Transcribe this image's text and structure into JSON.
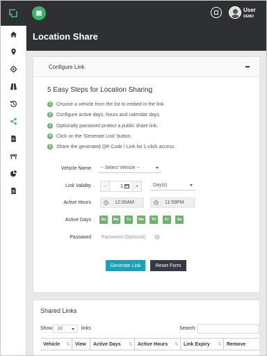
{
  "header": {
    "user_name": "User",
    "user_role": "DEMO"
  },
  "sidebar": {
    "items": [
      {
        "icon": "home-icon"
      },
      {
        "icon": "map-pin-icon"
      },
      {
        "icon": "crosshair-icon"
      },
      {
        "icon": "road-icon"
      },
      {
        "icon": "history-icon"
      },
      {
        "icon": "share-icon"
      },
      {
        "icon": "document-icon"
      },
      {
        "icon": "barrier-icon"
      },
      {
        "icon": "pie-chart-icon"
      },
      {
        "icon": "report-icon"
      }
    ]
  },
  "page": {
    "title": "Location Share"
  },
  "config": {
    "header_title": "Configure Link",
    "steps_title": "5 Easy Steps for Location Sharing",
    "steps": [
      {
        "num": "1",
        "text": "Choose a vehicle from the list to embed in the link."
      },
      {
        "num": "2",
        "text": "Configure active days, hours and calendar days."
      },
      {
        "num": "3",
        "text": "Optionally password protect a public share link."
      },
      {
        "num": "4",
        "text": "Click on the 'Generate Link' button."
      },
      {
        "num": "5",
        "text": "Share the generated QR Code / Link for 1-click access."
      }
    ],
    "vehicle_label": "Vehicle Name",
    "vehicle_value": "-- Select Vehicle --",
    "validity_label": "Link Validity",
    "validity_minus": "-",
    "validity_value": "1",
    "validity_plus": "+",
    "validity_unit": "Day(s)",
    "hours_label": "Active Hours",
    "hours_start": "12:00AM",
    "hours_end": "11:59PM",
    "days_label": "Active Days",
    "days": [
      "Su",
      "Mo",
      "Tu",
      "We",
      "Th",
      "Fr",
      "Sa"
    ],
    "password_label": "Password",
    "password_placeholder": "Password (Optional)",
    "generate_button": "Generate Link",
    "reset_button": "Reset Form"
  },
  "shared": {
    "title": "Shared Links",
    "show_label": "Show",
    "show_value": "10",
    "entries_label": "links",
    "search_label": "Search:",
    "columns": [
      "Vehicle",
      "View",
      "Active Days",
      "Active Hours",
      "Link Expiry",
      "Remove"
    ]
  },
  "colors": {
    "topbar": "#2f3033",
    "accent_green": "#3bb36a",
    "step_green": "#6db36a",
    "generate": "#17a2b8",
    "reset": "#343a40"
  }
}
